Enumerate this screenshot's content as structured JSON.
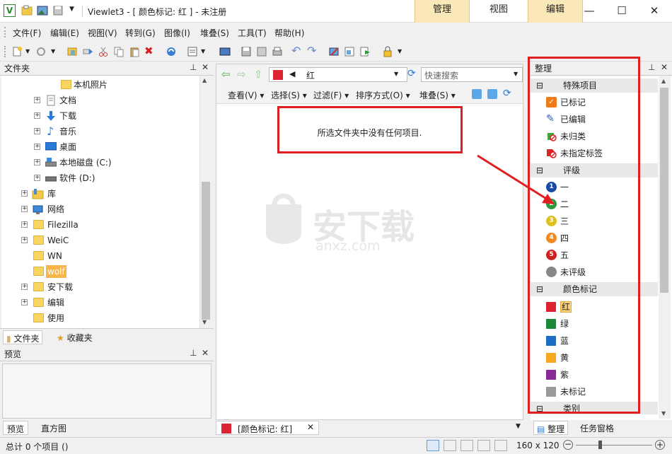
{
  "titlebar": {
    "logo": "V",
    "title": "Viewlet3 - [ 颜色标记: 红 ] - 未注册",
    "mode_tabs": [
      "管理",
      "视图",
      "编辑"
    ],
    "window_buttons": [
      "—",
      "☐",
      "✕"
    ]
  },
  "menu": [
    "文件(F)",
    "编辑(E)",
    "视图(V)",
    "转到(G)",
    "图像(I)",
    "堆叠(S)",
    "工具(T)",
    "帮助(H)"
  ],
  "left_pane": {
    "title": "文件夹",
    "tree": [
      {
        "label": "本机照片"
      },
      {
        "label": "文档"
      },
      {
        "label": "下载"
      },
      {
        "label": "音乐"
      },
      {
        "label": "桌面"
      },
      {
        "label": "本地磁盘 (C:)"
      },
      {
        "label": "软件 (D:)"
      },
      {
        "label": "库"
      },
      {
        "label": "网络"
      },
      {
        "label": "Filezilla"
      },
      {
        "label": "WeiC"
      },
      {
        "label": "WN"
      },
      {
        "label": "wolf"
      },
      {
        "label": "安下载"
      },
      {
        "label": "编辑"
      },
      {
        "label": "使用"
      }
    ],
    "tabs": [
      "文件夹",
      "收藏夹"
    ],
    "preview_title": "预览",
    "bottom_tabs": [
      "预览",
      "直方图"
    ]
  },
  "center": {
    "color_label": "红",
    "search_placeholder": "快速搜索",
    "view_items": [
      "查看(V)",
      "选择(S)",
      "过滤(F)",
      "排序方式(O)",
      "堆叠(S)"
    ],
    "empty_message": "所选文件夹中没有任何项目.",
    "watermark": "安下载",
    "watermark_sub": "anxz.com",
    "doc_tab": "[颜色标记: 红]"
  },
  "right_pane": {
    "title": "整理",
    "groups": [
      {
        "label": "特殊项目",
        "items": [
          "已标记",
          "已编辑",
          "未归类",
          "未指定标签"
        ]
      },
      {
        "label": "评级",
        "items": [
          "一",
          "二",
          "三",
          "四",
          "五",
          "未评级"
        ]
      },
      {
        "label": "颜色标记",
        "items": [
          "红",
          "绿",
          "蓝",
          "黄",
          "紫",
          "未标记"
        ]
      },
      {
        "label": "类别",
        "items": []
      }
    ],
    "rating_numbers": [
      "1",
      "2",
      "3",
      "4",
      "5"
    ],
    "color_hex": {
      "红": "#dd2233",
      "绿": "#1a8a3a",
      "蓝": "#1a6fc4",
      "黄": "#f7a823",
      "紫": "#8a2a9a",
      "未标记": "#999999"
    },
    "bottom_tabs": [
      "整理",
      "任务窗格"
    ]
  },
  "status": {
    "text": "总计 0 个项目 ()",
    "size": "160 x 120"
  }
}
